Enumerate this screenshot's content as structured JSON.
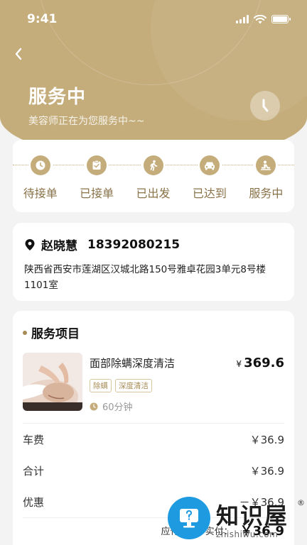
{
  "status_bar": {
    "time": "9:41"
  },
  "hero": {
    "title": "服务中",
    "subtitle": "美容师正在为您服务中~~"
  },
  "steps": [
    {
      "label": "待接单",
      "icon": "clock-icon"
    },
    {
      "label": "已接单",
      "icon": "clipboard-check-icon"
    },
    {
      "label": "已出发",
      "icon": "walking-icon"
    },
    {
      "label": "已达到",
      "icon": "car-icon"
    },
    {
      "label": "服务中",
      "icon": "massage-icon"
    }
  ],
  "address": {
    "name": "赵晓慧",
    "phone": "18392080215",
    "detail": "陕西省西安市莲湖区汉城北路150号雅卓花园3单元8号楼1101室"
  },
  "service": {
    "section_title": "服务项目",
    "item": {
      "name": "面部除螨深度清洁",
      "currency": "¥",
      "price": "369.6",
      "tags": [
        "除螨",
        "深度清洁"
      ],
      "duration": "60分钟"
    },
    "fees": [
      {
        "label": "车费",
        "value": "￥36.9"
      },
      {
        "label": "合计",
        "value": "￥36.9"
      },
      {
        "label": "优惠",
        "value": "－￥36.9"
      }
    ],
    "total": {
      "label_due": "应付款：",
      "label_paid": "实付：",
      "amount": "￥36.9"
    }
  },
  "watermark": {
    "text": "知识屋",
    "url": "zhishiwu.com",
    "reg": "®"
  },
  "colors": {
    "accent": "#c4ad7b",
    "accent_dark": "#8a7249",
    "background": "#f3f3f3"
  }
}
